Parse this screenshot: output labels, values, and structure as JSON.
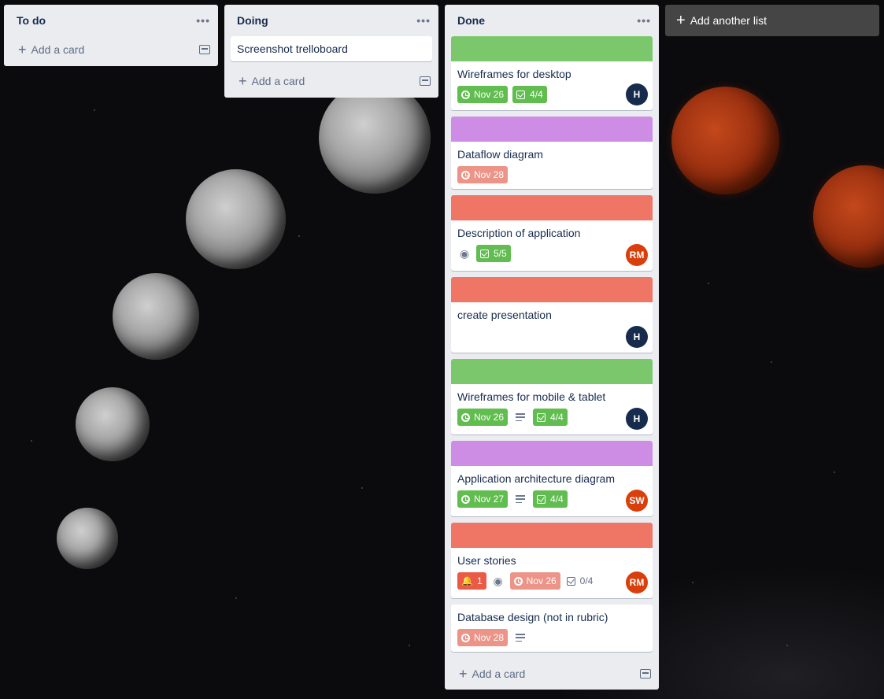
{
  "lists": [
    {
      "title": "To do",
      "menu": "•••",
      "add_card": "Add a card",
      "cards": []
    },
    {
      "title": "Doing",
      "menu": "•••",
      "add_card": "Add a card",
      "cards": [
        {
          "title": "Screenshot trelloboard"
        }
      ]
    },
    {
      "title": "Done",
      "menu": "•••",
      "add_card": "Add a card",
      "cards": [
        {
          "title": "Wireframes for desktop",
          "cover_color": "#7bc86c",
          "due": "Nov 26",
          "checklist": "4/4",
          "member": "H",
          "member_color": "#172b4d"
        },
        {
          "title": "Dataflow diagram",
          "cover_color": "#cd8de5",
          "due": "Nov 28"
        },
        {
          "title": "Description of application",
          "cover_color": "#ef7564",
          "checklist": "5/5",
          "member": "RM",
          "member_color": "#d93f0b"
        },
        {
          "title": "create presentation",
          "cover_color": "#ef7564",
          "member": "H",
          "member_color": "#172b4d"
        },
        {
          "title": "Wireframes for mobile & tablet",
          "cover_color": "#7bc86c",
          "due": "Nov 26",
          "checklist": "4/4",
          "member": "H",
          "member_color": "#172b4d"
        },
        {
          "title": "Application architecture diagram",
          "cover_color": "#cd8de5",
          "due": "Nov 27",
          "checklist": "4/4",
          "member": "SW",
          "member_color": "#d93f0b"
        },
        {
          "title": "User stories",
          "cover_color": "#ef7564",
          "notification": "1",
          "due": "Nov 26",
          "checklist": "0/4",
          "member": "RM",
          "member_color": "#d93f0b"
        },
        {
          "title": "Database design (not in rubric)",
          "due": "Nov 28"
        }
      ]
    }
  ],
  "add_list": "Add another list",
  "colors": {
    "list_bg": "#ebecf0",
    "green": "#61bd4f",
    "due_overdue": "#ec9488",
    "notification_red": "#eb5a46",
    "text": "#172b4d"
  }
}
